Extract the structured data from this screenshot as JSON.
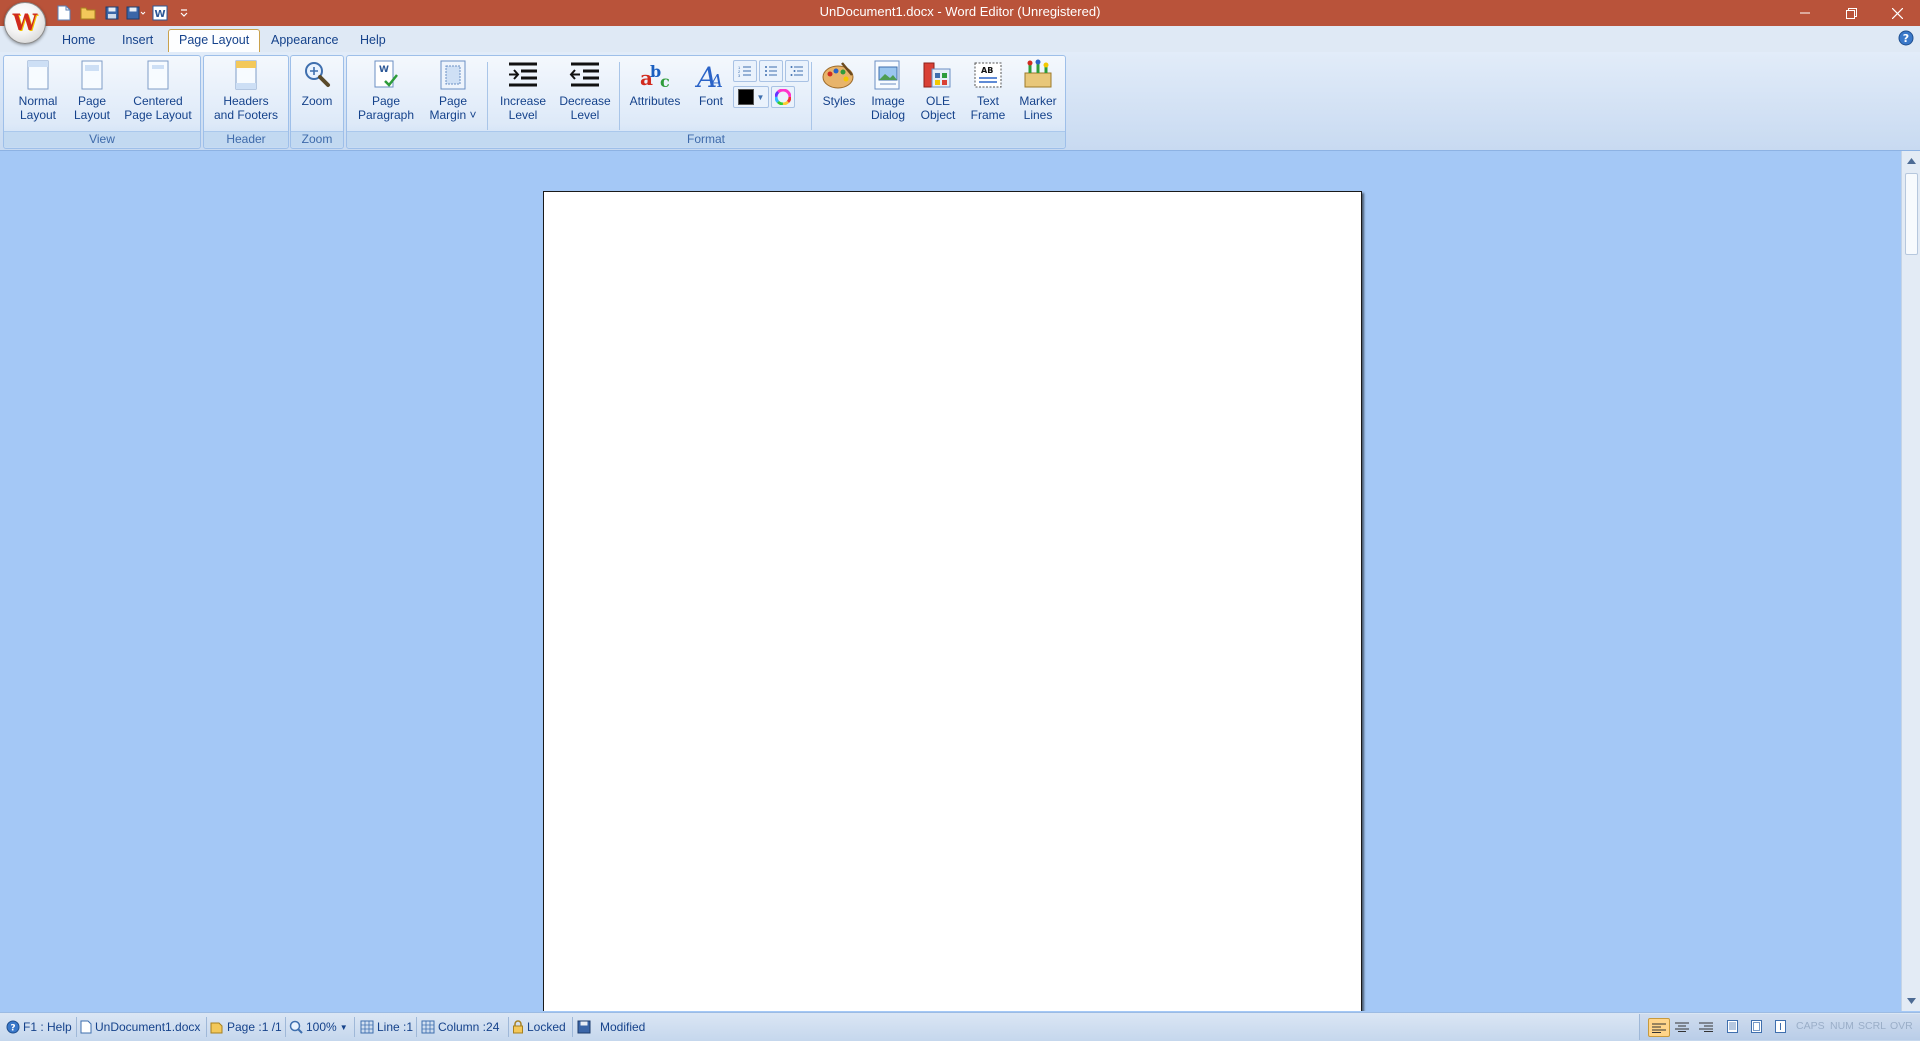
{
  "window": {
    "title": "UnDocument1.docx - Word Editor (Unregistered)",
    "app_icon": "word-editor-logo",
    "app_icon_letter": "W"
  },
  "quick_access": [
    "new-document-icon",
    "open-folder-icon",
    "save-icon",
    "save-as-icon",
    "word-export-icon",
    "customize-dropdown-icon"
  ],
  "tabs": [
    {
      "label": "Home",
      "active": false
    },
    {
      "label": "Insert",
      "active": false
    },
    {
      "label": "Page Layout",
      "active": true
    },
    {
      "label": "Appearance",
      "active": false
    },
    {
      "label": "Help",
      "active": false
    }
  ],
  "ribbon": {
    "groups": {
      "view": "View",
      "header": "Header",
      "zoom": "Zoom",
      "format": "Format"
    },
    "buttons": {
      "normal_layout": "Normal\nLayout",
      "page_layout": "Page\nLayout",
      "centered_page_layout": "Centered\nPage Layout",
      "headers_footers": "Headers\nand Footers",
      "zoom": "Zoom",
      "page_paragraph": "Page\nParagraph",
      "page_margin": "Page\nMargin ˅",
      "increase_level": "Increase\nLevel",
      "decrease_level": "Decrease\nLevel",
      "attributes": "Attributes",
      "font": "Font",
      "styles": "Styles",
      "image_dialog": "Image\nDialog",
      "ole_object": "OLE\nObject",
      "text_frame": "Text\nFrame",
      "marker_lines": "Marker\nLines"
    },
    "text_color": "#000000"
  },
  "statusbar": {
    "help": "F1 : Help",
    "file": "UnDocument1.docx",
    "page": "Page :1 /1",
    "zoom": "100%",
    "line": "Line :1",
    "column": "Column :24",
    "locked": "Locked",
    "modified": "Modified",
    "keys": [
      "CAPS",
      "NUM",
      "SCRL",
      "OVR"
    ]
  },
  "colors": {
    "titlebar": "#b9533a",
    "workspace": "#a4c8f6",
    "ribbon_text": "#15428b"
  }
}
